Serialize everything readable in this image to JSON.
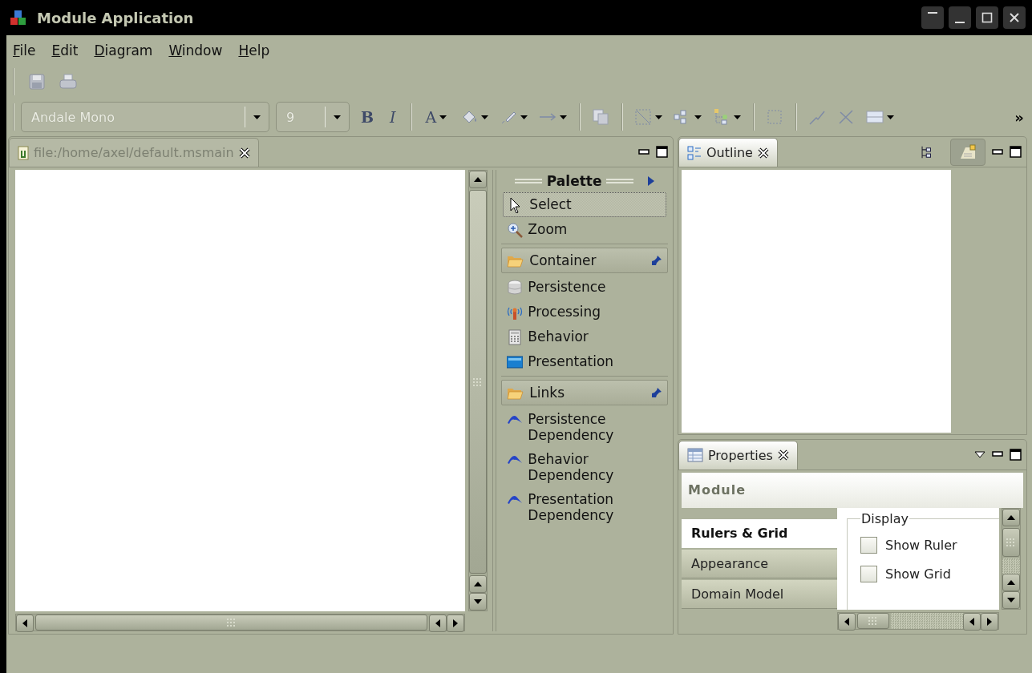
{
  "window": {
    "title": "Module Application"
  },
  "menu": [
    {
      "label": "File"
    },
    {
      "label": "Edit"
    },
    {
      "label": "Diagram"
    },
    {
      "label": "Window"
    },
    {
      "label": "Help"
    }
  ],
  "toolbar": {
    "font": {
      "value": "Andale Mono",
      "disabled": true
    },
    "size": {
      "value": "9",
      "disabled": true
    },
    "bold": "B",
    "italic": "I",
    "font_color": "A",
    "overflow": "»"
  },
  "editor": {
    "tab": {
      "label": "file:/home/axel/default.msmain",
      "active": false
    }
  },
  "palette": {
    "title": "Palette",
    "entries": [
      {
        "kind": "pointer",
        "label": "Select",
        "selected": true
      },
      {
        "kind": "zoom",
        "label": "Zoom",
        "selected": false
      },
      {
        "kind": "drawer",
        "label": "Container",
        "expanded": true,
        "pinned": true,
        "children": [
          {
            "kind": "database",
            "label": "Persistence",
            "selected": false
          },
          {
            "kind": "antenna",
            "label": "Processing",
            "selected": false
          },
          {
            "kind": "calculator",
            "label": "Behavior",
            "selected": false
          },
          {
            "kind": "screen",
            "label": "Presentation",
            "selected": false
          }
        ]
      },
      {
        "kind": "drawer",
        "label": "Links",
        "expanded": true,
        "pinned": true,
        "children": [
          {
            "kind": "link",
            "label": "Persistence Dependency",
            "selected": false
          },
          {
            "kind": "link",
            "label": "Behavior Dependency",
            "selected": false
          },
          {
            "kind": "link",
            "label": "Presentation Dependency",
            "selected": false
          }
        ]
      }
    ]
  },
  "outline": {
    "tab": {
      "label": "Outline",
      "active": true
    },
    "tools": [
      {
        "kind": "tree",
        "pressed": false
      },
      {
        "kind": "overview",
        "pressed": true
      }
    ]
  },
  "properties": {
    "tab": {
      "label": "Properties",
      "active": true
    },
    "title": "Module",
    "sections": [
      {
        "label": "Rulers & Grid",
        "selected": true
      },
      {
        "label": "Appearance",
        "selected": false
      },
      {
        "label": "Domain Model",
        "selected": false
      }
    ],
    "group": {
      "label": "Display",
      "options": [
        {
          "label": "Show Ruler",
          "checked": false
        },
        {
          "label": "Show Grid",
          "checked": false
        }
      ]
    }
  }
}
